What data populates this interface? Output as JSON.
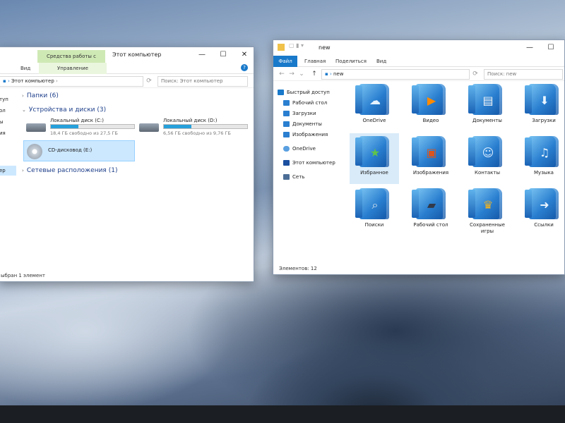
{
  "left_window": {
    "title": "Этот компьютер",
    "context_tab": "Средства работы с дисками",
    "tabs": [
      "Вид",
      "Управление"
    ],
    "address": "Этот компьютер",
    "search_placeholder": "Поиск: Этот компьютер",
    "sections": {
      "folders": "Папки (6)",
      "devices": "Устройства и диски (3)",
      "network": "Сетевые расположения (1)"
    },
    "drives": [
      {
        "name": "Локальный диск (C:)",
        "free": "18,4 ГБ свободно из 27,5 ГБ",
        "used_fraction": 0.33
      },
      {
        "name": "Локальный диск (D:)",
        "free": "6,56 ГБ свободно из 9,76 ГБ",
        "used_fraction": 0.33
      },
      {
        "name": "CD-дисковод (E:)"
      }
    ],
    "nav_fragments": [
      "туп",
      "ол",
      "ы",
      "ия",
      "ер"
    ],
    "status": "ыбран 1 элемент"
  },
  "right_window": {
    "title": "new",
    "tabs": [
      "Файл",
      "Главная",
      "Поделиться",
      "Вид"
    ],
    "address": "new",
    "search_placeholder": "Поиск: new",
    "nav": [
      {
        "label": "Быстрый доступ",
        "icon": "star-icon"
      },
      {
        "label": "Рабочий стол",
        "icon": "desktop-icon"
      },
      {
        "label": "Загрузки",
        "icon": "download-icon"
      },
      {
        "label": "Документы",
        "icon": "document-icon"
      },
      {
        "label": "Изображения",
        "icon": "image-icon"
      },
      {
        "label": "OneDrive",
        "icon": "cloud-icon"
      },
      {
        "label": "Этот компьютер",
        "icon": "computer-icon"
      },
      {
        "label": "Сеть",
        "icon": "network-icon"
      }
    ],
    "items": [
      {
        "label": "OneDrive",
        "emblem": "☁"
      },
      {
        "label": "Видео",
        "emblem": "▶"
      },
      {
        "label": "Документы",
        "emblem": "▤"
      },
      {
        "label": "Загрузки",
        "emblem": "⬇"
      },
      {
        "label": "Избранное",
        "emblem": "★"
      },
      {
        "label": "Изображения",
        "emblem": "▣"
      },
      {
        "label": "Контакты",
        "emblem": "☺"
      },
      {
        "label": "Музыка",
        "emblem": "♫"
      },
      {
        "label": "Поиски",
        "emblem": "⌕"
      },
      {
        "label": "Рабочий стол",
        "emblem": "▰"
      },
      {
        "label": "Сохраненные игры",
        "emblem": "♛"
      },
      {
        "label": "Ссылки",
        "emblem": "➜"
      }
    ],
    "status": "Элементов: 12"
  },
  "colors": {
    "accent": "#1979ca",
    "selection": "#cce8ff",
    "link": "#1e3f8a"
  }
}
